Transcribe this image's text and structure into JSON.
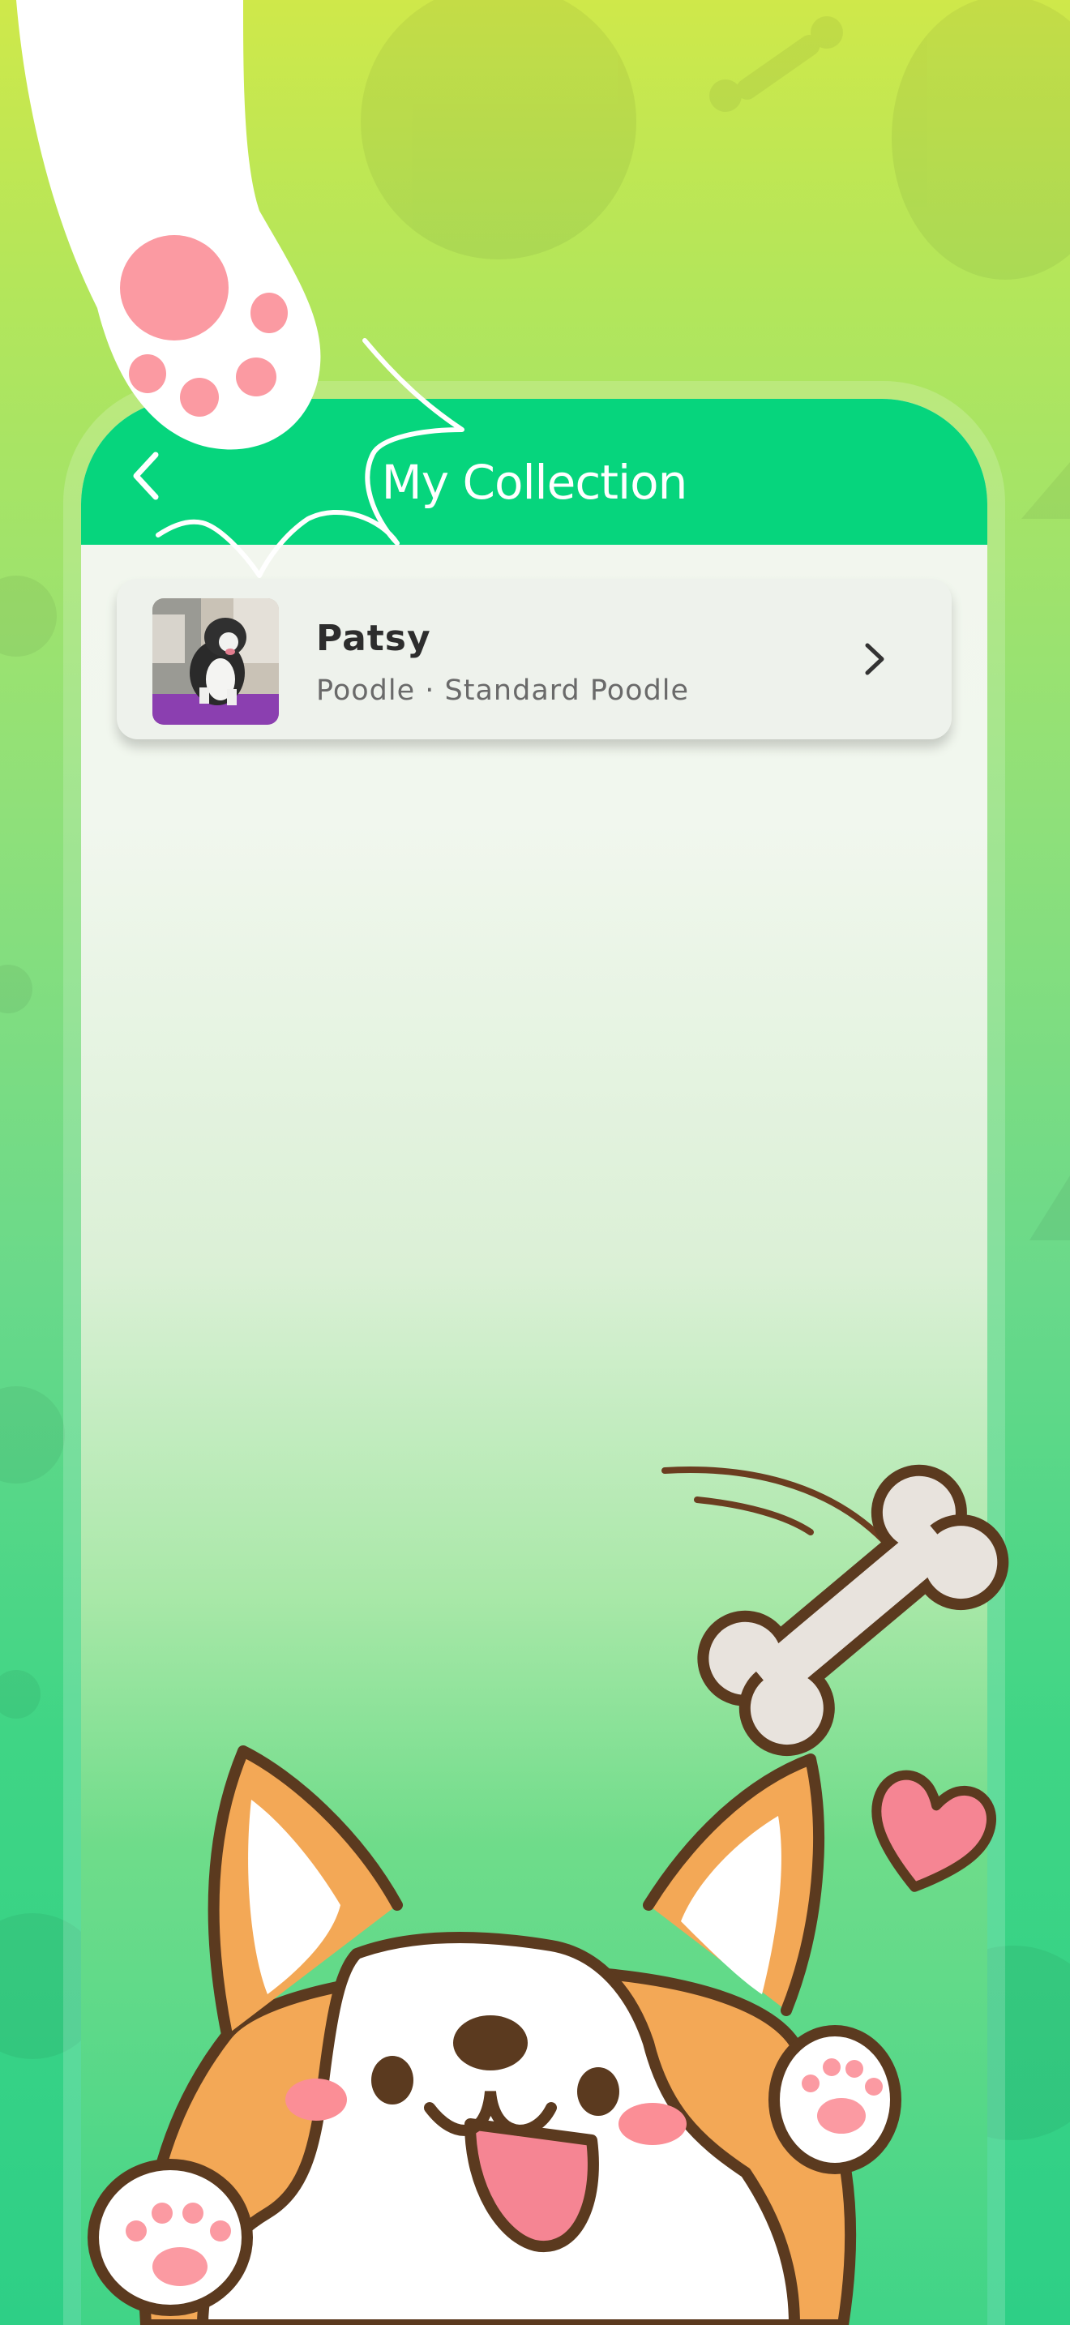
{
  "header": {
    "title": "My Collection",
    "back_icon": "chevron-left-icon"
  },
  "collection": {
    "items": [
      {
        "name": "Patsy",
        "breed": "Poodle · Standard Poodle",
        "arrow_icon": "chevron-right-icon"
      }
    ]
  },
  "colors": {
    "header": "#06d57d",
    "card": "#eef2ec",
    "background_top": "#cfe84a",
    "background_bottom": "#2ecf86"
  }
}
